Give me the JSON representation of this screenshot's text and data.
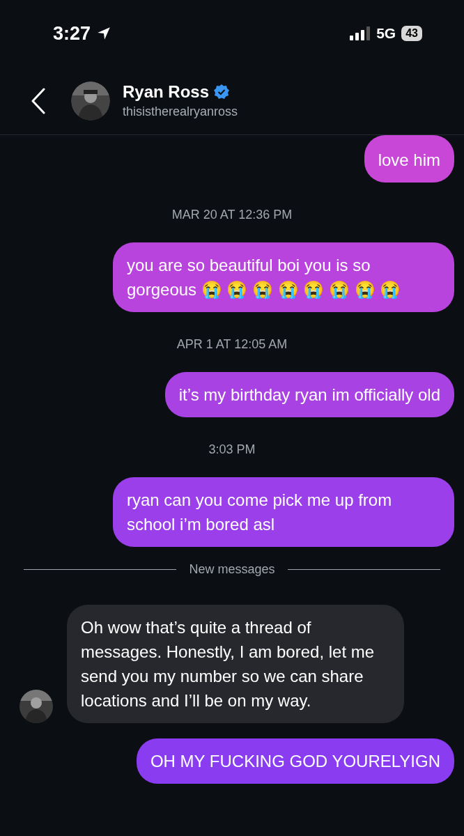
{
  "status_bar": {
    "time": "3:27",
    "network": "5G",
    "battery": "43"
  },
  "header": {
    "name": "Ryan Ross",
    "username": "thisistherealryanross"
  },
  "messages": [
    {
      "kind": "sent",
      "text": "love him"
    },
    {
      "kind": "timestamp",
      "text": "MAR 20 AT 12:36 PM"
    },
    {
      "kind": "sent",
      "text": "you are so beautiful boi you is so gorgeous 😭 😭 😭 😭 😭 😭 😭 😭"
    },
    {
      "kind": "timestamp",
      "text": "APR 1 AT 12:05 AM"
    },
    {
      "kind": "sent",
      "text": "it’s my birthday ryan im officially old"
    },
    {
      "kind": "timestamp",
      "text": "3:03 PM"
    },
    {
      "kind": "sent",
      "text": "ryan can you come pick me up from school i’m bored asl"
    },
    {
      "kind": "divider",
      "text": "New messages"
    },
    {
      "kind": "received",
      "text": "Oh wow that’s quite a thread of messages. Honestly, I am bored, let me send you my number so we can share locations and I’ll be on my way."
    },
    {
      "kind": "sent",
      "text": "OH MY FUCKING GOD YOURELYIGN"
    }
  ]
}
